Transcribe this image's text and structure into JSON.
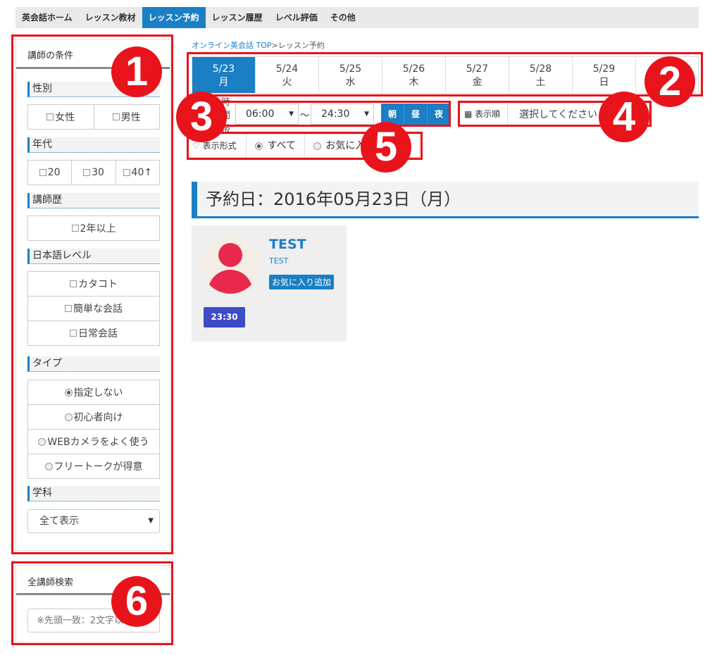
{
  "nav": {
    "items": [
      {
        "label": "英会話ホーム",
        "active": false
      },
      {
        "label": "レッスン教材",
        "active": false
      },
      {
        "label": "レッスン予約",
        "active": true
      },
      {
        "label": "レッスン履歴",
        "active": false
      },
      {
        "label": "レベル評価",
        "active": false
      },
      {
        "label": "その他",
        "active": false
      }
    ]
  },
  "sidebar": {
    "title": "講師の条件",
    "gender": {
      "title": "性別",
      "options": [
        "女性",
        "男性"
      ]
    },
    "age": {
      "title": "年代",
      "options": [
        "20",
        "30",
        "40↑"
      ]
    },
    "career": {
      "title": "講師歴",
      "options": [
        "2年以上"
      ]
    },
    "japanese": {
      "title": "日本語レベル",
      "options": [
        "カタコト",
        "簡単な会話",
        "日常会話"
      ]
    },
    "type": {
      "title": "タイプ",
      "options": [
        "指定しない",
        "初心者向け",
        "WEBカメラをよく使う",
        "フリートークが得意"
      ],
      "selected": "指定しない"
    },
    "subject": {
      "title": "学科",
      "value": "全て表示"
    }
  },
  "search": {
    "title": "全講師検索",
    "placeholder": "※先頭一致：2文字以上"
  },
  "breadcrumb": {
    "home": "オンライン英会話 TOP",
    "sep": ">",
    "current": "レッスン予約"
  },
  "days": [
    {
      "date": "5/23",
      "dow": "月",
      "active": true
    },
    {
      "date": "5/24",
      "dow": "火"
    },
    {
      "date": "5/25",
      "dow": "水"
    },
    {
      "date": "5/26",
      "dow": "木"
    },
    {
      "date": "5/27",
      "dow": "金"
    },
    {
      "date": "5/28",
      "dow": "土"
    },
    {
      "date": "5/29",
      "dow": "日"
    }
  ],
  "time_filter": {
    "label": "時間帯",
    "from": "06:00",
    "tilde": "〜",
    "to": "24:30",
    "periods": [
      "朝",
      "昼",
      "夜"
    ]
  },
  "sort": {
    "label": "表示順",
    "value": "選択してください"
  },
  "view": {
    "label": "表示形式",
    "options": [
      "すべて",
      "お気に入り"
    ],
    "selected": "すべて"
  },
  "date_heading": "予約日：2016年05月23日（月）",
  "teacher": {
    "name": "TEST",
    "sub": "TEST",
    "fav_label": "お気に入り追加",
    "slots": [
      "23:30"
    ]
  },
  "annotations": [
    "1",
    "2",
    "3",
    "4",
    "5",
    "6"
  ],
  "colors": {
    "accent": "#1a7fc4",
    "annotation": "#e8131b",
    "avatar": "#e8294d",
    "slot": "#3c4bc6"
  }
}
